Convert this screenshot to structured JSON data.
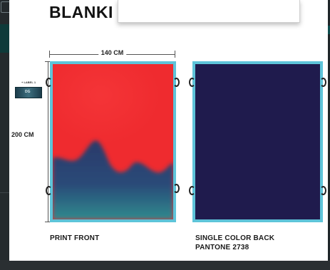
{
  "header": {
    "title": "BLANKI"
  },
  "dimensions": {
    "width_label": "140 CM",
    "height_label": "200 CM"
  },
  "label_thumb": {
    "caption": "+ LABEL 1",
    "text": "DG"
  },
  "panels": {
    "front_caption": "PRINT FRONT",
    "back_caption_line1": "SINGLE COLOR BACK",
    "back_caption_line2": "PANTONE 2738"
  },
  "colors": {
    "panel_border": "#5ec4d9",
    "front_red": "#ef2b2f",
    "front_navy": "#2c3a6a",
    "front_teal": "#2f8a8e",
    "back_fill": "#1f1b4d"
  }
}
